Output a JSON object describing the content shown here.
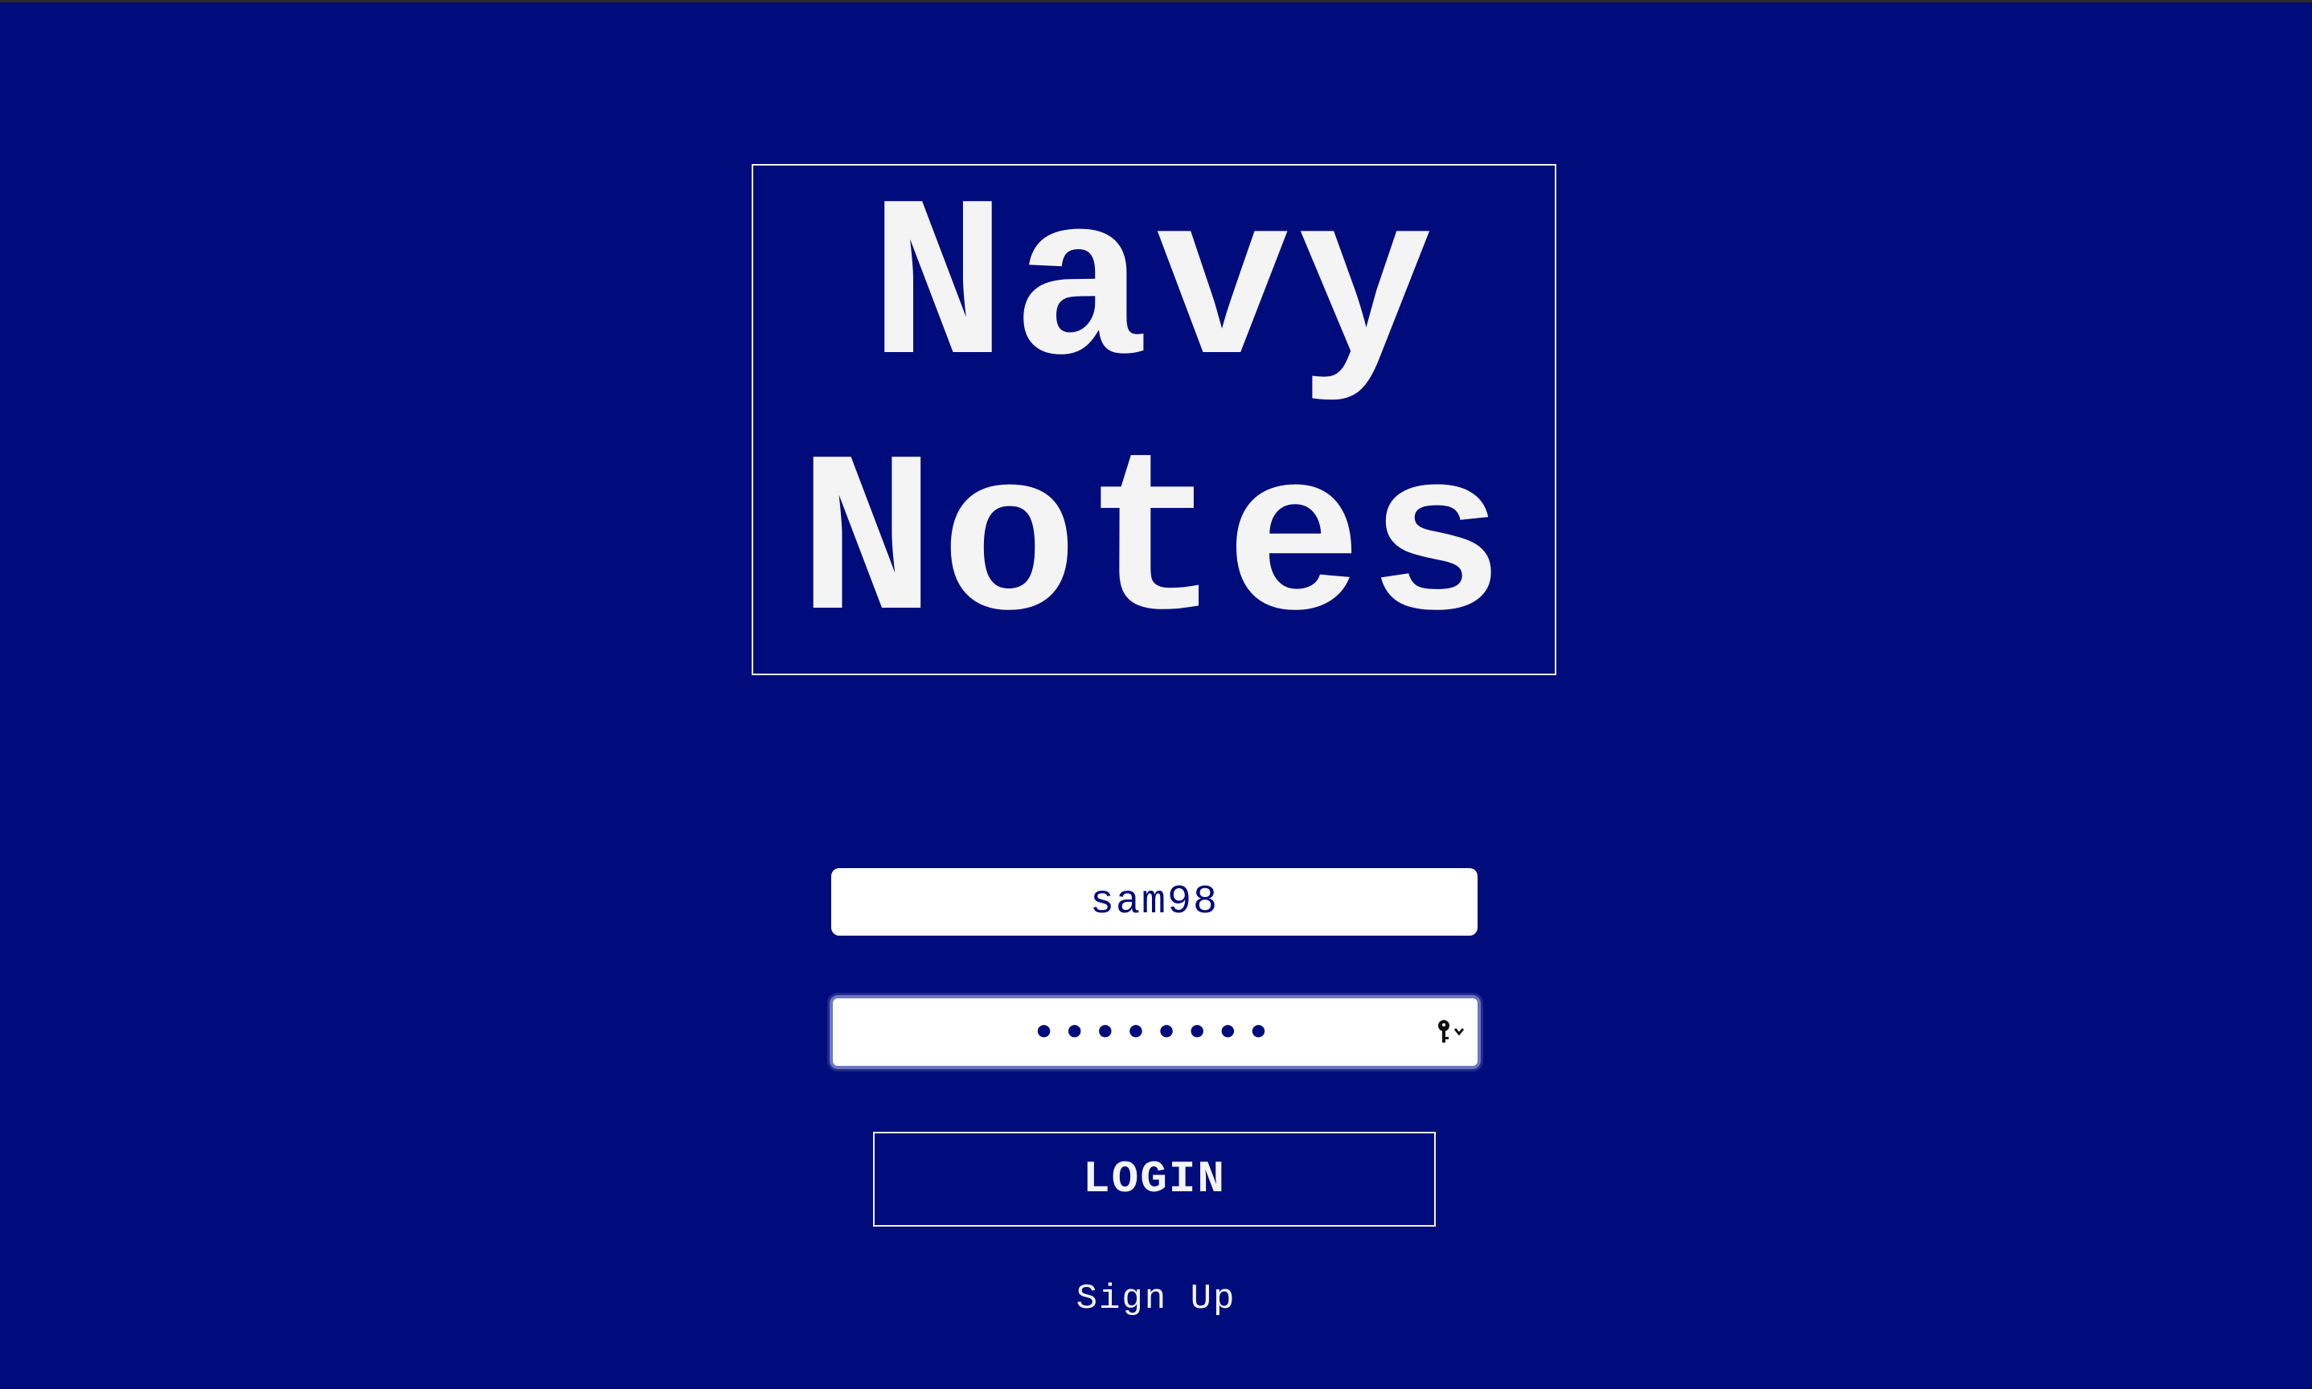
{
  "app": {
    "title_line1": "Navy",
    "title_line2": "Notes"
  },
  "login_form": {
    "username_value": "sam98",
    "password_masked": "••••••••",
    "password_autofill_icon": "key-icon",
    "login_label": "LOGIN",
    "signup_label": "Sign Up"
  },
  "colors": {
    "background": "#000c7b",
    "text": "#f4f4f4",
    "field_text": "#000c7b"
  }
}
